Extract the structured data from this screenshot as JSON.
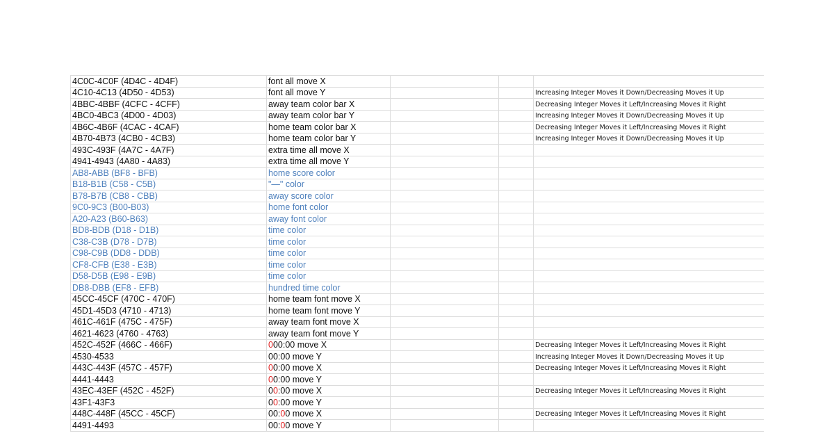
{
  "rows": [
    {
      "addr": "4C0C-4C0F (4D4C - 4D4F)",
      "desc": "font all move X",
      "note": "",
      "blue": false
    },
    {
      "addr": "4C10-4C13 (4D50 - 4D53)",
      "desc": "font all move Y",
      "note": "Increasing  Integer Moves it Down/Decreasing Moves it Up",
      "blue": false
    },
    {
      "addr": "4BBC-4BBF (4CFC - 4CFF)",
      "desc": "away team color bar X",
      "note": "Decreasing Integer Moves it Left/Increasing Moves it Right",
      "blue": false
    },
    {
      "addr": "4BC0-4BC3 (4D00 - 4D03)",
      "desc": "away team color bar Y",
      "note": "Increasing  Integer Moves it Down/Decreasing Moves it Up",
      "blue": false
    },
    {
      "addr": "4B6C-4B6F (4CAC - 4CAF)",
      "desc": "home team color bar X",
      "note": "Decreasing Integer Moves it Left/Increasing Moves it Right",
      "blue": false
    },
    {
      "addr": "4B70-4B73 (4CB0 - 4CB3)",
      "desc": "home team color bar Y",
      "note": "Increasing  Integer Moves it Down/Decreasing Moves it Up",
      "blue": false
    },
    {
      "addr": "493C-493F (4A7C - 4A7F)",
      "desc": "extra time all move X",
      "note": "",
      "blue": false
    },
    {
      "addr": "4941-4943 (4A80 - 4A83)",
      "desc": "extra time all move Y",
      "note": "",
      "blue": false
    },
    {
      "addr": "AB8-ABB (BF8 - BFB)",
      "desc": "home score color",
      "note": "",
      "blue": true
    },
    {
      "addr": "B18-B1B (C58 - C5B)",
      "desc": "\"—\" color",
      "note": "",
      "blue": true
    },
    {
      "addr": "B78-B7B (CB8 - CBB)",
      "desc": "away score color",
      "note": "",
      "blue": true
    },
    {
      "addr": "9C0-9C3 (B00-B03)",
      "desc": "home font color",
      "note": "",
      "blue": true
    },
    {
      "addr": "A20-A23 (B60-B63)",
      "desc": "away font color",
      "note": "",
      "blue": true
    },
    {
      "addr": "BD8-BDB (D18 - D1B)",
      "desc": "time color",
      "note": "",
      "blue": true
    },
    {
      "addr": "C38-C3B (D78 - D7B)",
      "desc": "time color",
      "note": "",
      "blue": true
    },
    {
      "addr": "C98-C9B (DD8 - DDB)",
      "desc": "time color",
      "note": "",
      "blue": true
    },
    {
      "addr": "CF8-CFB (E38 - E3B)",
      "desc": "time color",
      "note": "",
      "blue": true
    },
    {
      "addr": "D58-D5B (E98 - E9B)",
      "desc": "time color",
      "note": "",
      "blue": true
    },
    {
      "addr": "DB8-DBB (EF8 - EFB)",
      "desc": "hundred time color",
      "note": "",
      "blue": true
    },
    {
      "addr": "45CC-45CF (470C - 470F)",
      "desc": "home team font move X",
      "note": "",
      "blue": false
    },
    {
      "addr": "45D1-45D3 (4710 - 4713)",
      "desc": "home team font move Y",
      "note": "",
      "blue": false
    },
    {
      "addr": "461C-461F (475C - 475F)",
      "desc": "away team font move X",
      "note": "",
      "blue": false
    },
    {
      "addr": "4621-4623 (4760 - 4763)",
      "desc": "away team font move Y",
      "note": "",
      "blue": false
    },
    {
      "addr": "452C-452F (466C - 466F)",
      "desc_red": "0",
      "desc_black": "00:00 move X",
      "note": "Decreasing Integer Moves it Left/Increasing Moves it Right",
      "blue": false
    },
    {
      "addr": "4530-4533",
      "desc_black": "00:00 move Y",
      "note": "Increasing  Integer Moves it Down/Decreasing Moves it Up",
      "blue": false
    },
    {
      "addr": "443C-443F (457C - 457F)",
      "desc_red": "0",
      "desc_black": "0:00 move X",
      "note": "Decreasing Integer Moves it Left/Increasing Moves it Right",
      "blue": false
    },
    {
      "addr": "4441-4443",
      "desc_red": "0",
      "desc_black": "0:00 move Y",
      "note": "",
      "blue": false
    },
    {
      "addr": "43EC-43EF (452C - 452F)",
      "desc_pre": "0",
      "desc_red": "0",
      "desc_black": ":00 move X",
      "note": "Decreasing Integer Moves it Left/Increasing Moves it Right",
      "blue": false
    },
    {
      "addr": "43F1-43F3",
      "desc_pre": "0",
      "desc_red": "0",
      "desc_black": ":00 move Y",
      "note": "",
      "blue": false
    },
    {
      "addr": "448C-448F (45CC - 45CF)",
      "desc_pre": "00:",
      "desc_red": "0",
      "desc_black": "0 move X",
      "note": "Decreasing Integer Moves it Left/Increasing Moves it Right",
      "blue": false
    },
    {
      "addr": "4491-4493",
      "desc_pre": "00:",
      "desc_red": "0",
      "desc_black": "0 move Y",
      "note": "",
      "blue": false
    }
  ],
  "colors": {
    "blue_text": "#4f81bd",
    "red_text": "#e02020",
    "grid": "#dcdcdc"
  }
}
